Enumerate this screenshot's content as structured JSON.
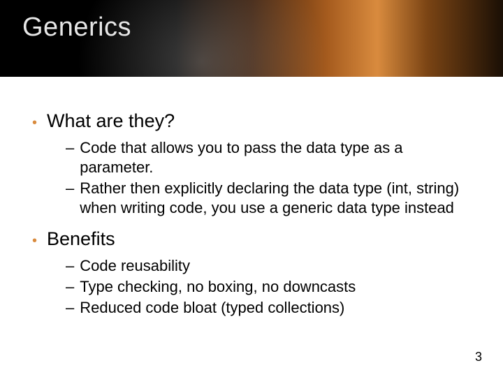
{
  "title": "Generics",
  "bullets": [
    {
      "label": "What are they?",
      "subs": [
        "Code that allows you to pass the data type as a parameter.",
        "Rather then explicitly declaring the data type (int, string) when writing code, you use a generic data type instead"
      ]
    },
    {
      "label": "Benefits",
      "subs": [
        "Code reusability",
        "Type checking, no boxing, no downcasts",
        "Reduced code bloat (typed collections)"
      ]
    }
  ],
  "pageNumber": "3",
  "colors": {
    "accent": "#d98b3e"
  }
}
